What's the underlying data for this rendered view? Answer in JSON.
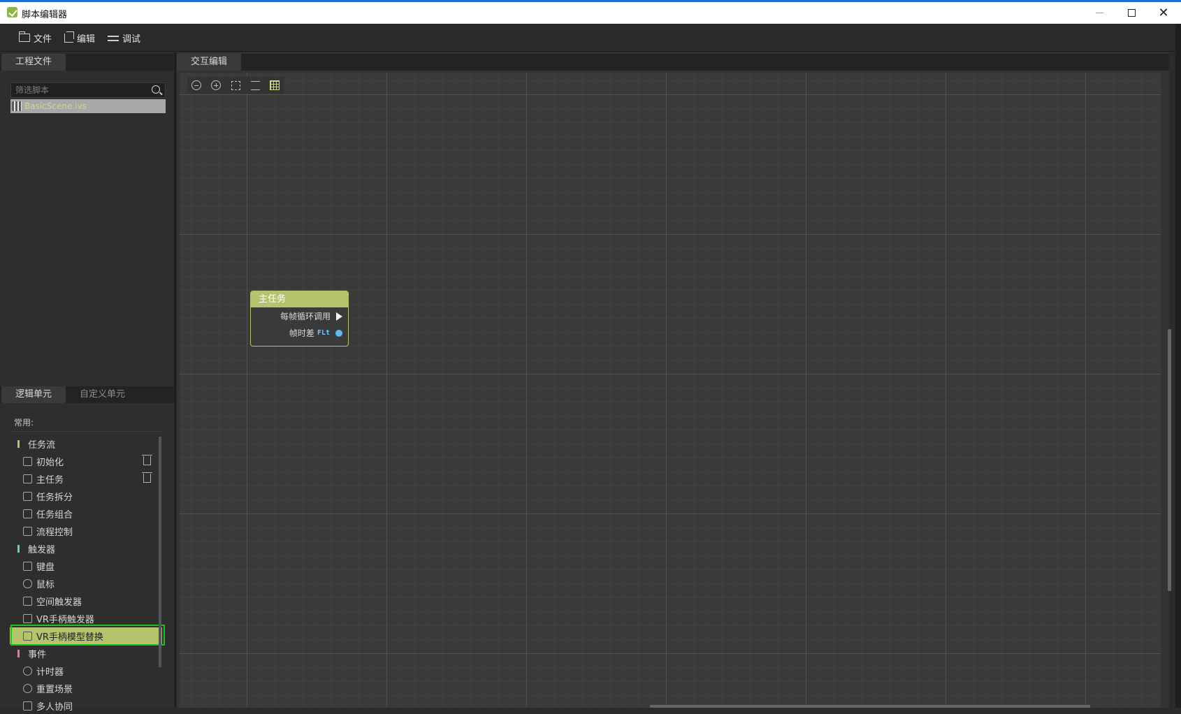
{
  "window": {
    "title": "脚本编辑器",
    "controls": {
      "minimize": "—",
      "maximize": "□",
      "close": "✕"
    }
  },
  "menu": {
    "file": "文件",
    "edit": "编辑",
    "debug": "调试"
  },
  "project_panel": {
    "tab": "工程文件",
    "filter_placeholder": "筛选脚本",
    "files": [
      "BasicScene.ivs"
    ]
  },
  "editor": {
    "tab": "交互编辑",
    "node": {
      "title": "主任务",
      "port_exec": "每帧循环调用",
      "port_delta": "帧时差",
      "port_delta_type": "FLt"
    }
  },
  "units_panel": {
    "tabs": [
      "逻辑单元",
      "自定义单元"
    ],
    "section": "常用:",
    "items": [
      {
        "label": "任务流",
        "kind": "category",
        "color": "#b4c46d"
      },
      {
        "label": "初始化",
        "kind": "item",
        "trash": true
      },
      {
        "label": "主任务",
        "kind": "item",
        "trash": true
      },
      {
        "label": "任务拆分",
        "kind": "item"
      },
      {
        "label": "任务组合",
        "kind": "item"
      },
      {
        "label": "流程控制",
        "kind": "item"
      },
      {
        "label": "触发器",
        "kind": "category",
        "color": "#5ed1c9"
      },
      {
        "label": "键盘",
        "kind": "item"
      },
      {
        "label": "鼠标",
        "kind": "item"
      },
      {
        "label": "空间触发器",
        "kind": "item"
      },
      {
        "label": "VR手柄触发器",
        "kind": "item"
      },
      {
        "label": "VR手柄模型替换",
        "kind": "item",
        "selected": true
      },
      {
        "label": "事件",
        "kind": "category",
        "color": "#e87d8a"
      },
      {
        "label": "计时器",
        "kind": "item"
      },
      {
        "label": "重置场景",
        "kind": "item"
      },
      {
        "label": "多人协同",
        "kind": "item"
      }
    ]
  },
  "colors": {
    "accent": "#b4c46d",
    "selection_frame": "#1fc21f",
    "port_float": "#5fb8f5"
  }
}
